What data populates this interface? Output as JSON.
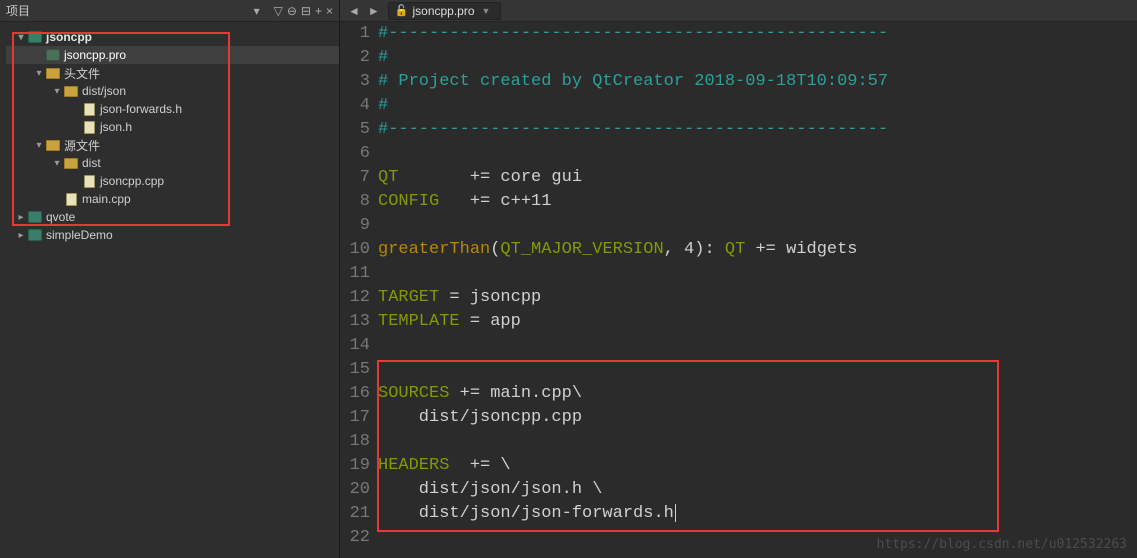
{
  "sidebar": {
    "title": "项目",
    "toolbar_icons": [
      "filter-icon",
      "link-icon",
      "split-icon",
      "add-icon",
      "close-icon"
    ],
    "tree": [
      {
        "indent": 0,
        "tw": "▾",
        "icon": "proj",
        "label": "jsoncpp",
        "bold": true,
        "sel": false
      },
      {
        "indent": 1,
        "tw": "",
        "icon": "pro",
        "label": "jsoncpp.pro",
        "bold": false,
        "sel": true
      },
      {
        "indent": 1,
        "tw": "▾",
        "icon": "folder",
        "label": "头文件",
        "bold": false,
        "sel": false
      },
      {
        "indent": 2,
        "tw": "▾",
        "icon": "folder",
        "label": "dist/json",
        "bold": false,
        "sel": false
      },
      {
        "indent": 3,
        "tw": "",
        "icon": "hdr",
        "label": "json-forwards.h",
        "bold": false,
        "sel": false
      },
      {
        "indent": 3,
        "tw": "",
        "icon": "hdr",
        "label": "json.h",
        "bold": false,
        "sel": false
      },
      {
        "indent": 1,
        "tw": "▾",
        "icon": "folder",
        "label": "源文件",
        "bold": false,
        "sel": false
      },
      {
        "indent": 2,
        "tw": "▾",
        "icon": "folder",
        "label": "dist",
        "bold": false,
        "sel": false
      },
      {
        "indent": 3,
        "tw": "",
        "icon": "cpp",
        "label": "jsoncpp.cpp",
        "bold": false,
        "sel": false
      },
      {
        "indent": 2,
        "tw": "",
        "icon": "cpp",
        "label": "main.cpp",
        "bold": false,
        "sel": false
      },
      {
        "indent": 0,
        "tw": "▸",
        "icon": "proj",
        "label": "qvote",
        "bold": false,
        "sel": false
      },
      {
        "indent": 0,
        "tw": "▸",
        "icon": "proj",
        "label": "simpleDemo",
        "bold": false,
        "sel": false
      }
    ]
  },
  "editor": {
    "file_name": "jsoncpp.pro",
    "lines": [
      {
        "n": 1,
        "tokens": [
          {
            "c": "cyan",
            "t": "#-------------------------------------------------"
          }
        ]
      },
      {
        "n": 2,
        "tokens": [
          {
            "c": "cyan",
            "t": "#"
          }
        ]
      },
      {
        "n": 3,
        "tokens": [
          {
            "c": "cyan",
            "t": "# Project created by QtCreator 2018-09-18T10:09:57"
          }
        ]
      },
      {
        "n": 4,
        "tokens": [
          {
            "c": "cyan",
            "t": "#"
          }
        ]
      },
      {
        "n": 5,
        "tokens": [
          {
            "c": "cyan",
            "t": "#-------------------------------------------------"
          }
        ]
      },
      {
        "n": 6,
        "tokens": []
      },
      {
        "n": 7,
        "tokens": [
          {
            "c": "olive",
            "t": "QT"
          },
          {
            "c": "gray",
            "t": "       += core gui"
          }
        ]
      },
      {
        "n": 8,
        "tokens": [
          {
            "c": "olive",
            "t": "CONFIG"
          },
          {
            "c": "gray",
            "t": "   += c++11"
          }
        ]
      },
      {
        "n": 9,
        "tokens": []
      },
      {
        "n": 10,
        "tokens": [
          {
            "c": "yellow",
            "t": "greaterThan"
          },
          {
            "c": "gray",
            "t": "("
          },
          {
            "c": "olive",
            "t": "QT_MAJOR_VERSION"
          },
          {
            "c": "gray",
            "t": ", 4): "
          },
          {
            "c": "olive",
            "t": "QT"
          },
          {
            "c": "gray",
            "t": " += widgets"
          }
        ]
      },
      {
        "n": 11,
        "tokens": []
      },
      {
        "n": 12,
        "tokens": [
          {
            "c": "olive",
            "t": "TARGET"
          },
          {
            "c": "gray",
            "t": " = jsoncpp"
          }
        ]
      },
      {
        "n": 13,
        "tokens": [
          {
            "c": "olive",
            "t": "TEMPLATE"
          },
          {
            "c": "gray",
            "t": " = app"
          }
        ]
      },
      {
        "n": 14,
        "tokens": []
      },
      {
        "n": 15,
        "tokens": []
      },
      {
        "n": 16,
        "tokens": [
          {
            "c": "olive",
            "t": "SOURCES"
          },
          {
            "c": "gray",
            "t": " += main.cpp\\"
          }
        ]
      },
      {
        "n": 17,
        "tokens": [
          {
            "c": "gray",
            "t": "    dist/jsoncpp.cpp"
          }
        ]
      },
      {
        "n": 18,
        "tokens": []
      },
      {
        "n": 19,
        "tokens": [
          {
            "c": "olive",
            "t": "HEADERS"
          },
          {
            "c": "gray",
            "t": "  += \\"
          }
        ]
      },
      {
        "n": 20,
        "tokens": [
          {
            "c": "gray",
            "t": "    dist/json/json.h \\"
          }
        ]
      },
      {
        "n": 21,
        "tokens": [
          {
            "c": "gray",
            "t": "    dist/json/json-forwards.h"
          }
        ],
        "cursor": true
      },
      {
        "n": 22,
        "tokens": []
      }
    ]
  },
  "watermark": "https://blog.csdn.net/u012532263"
}
